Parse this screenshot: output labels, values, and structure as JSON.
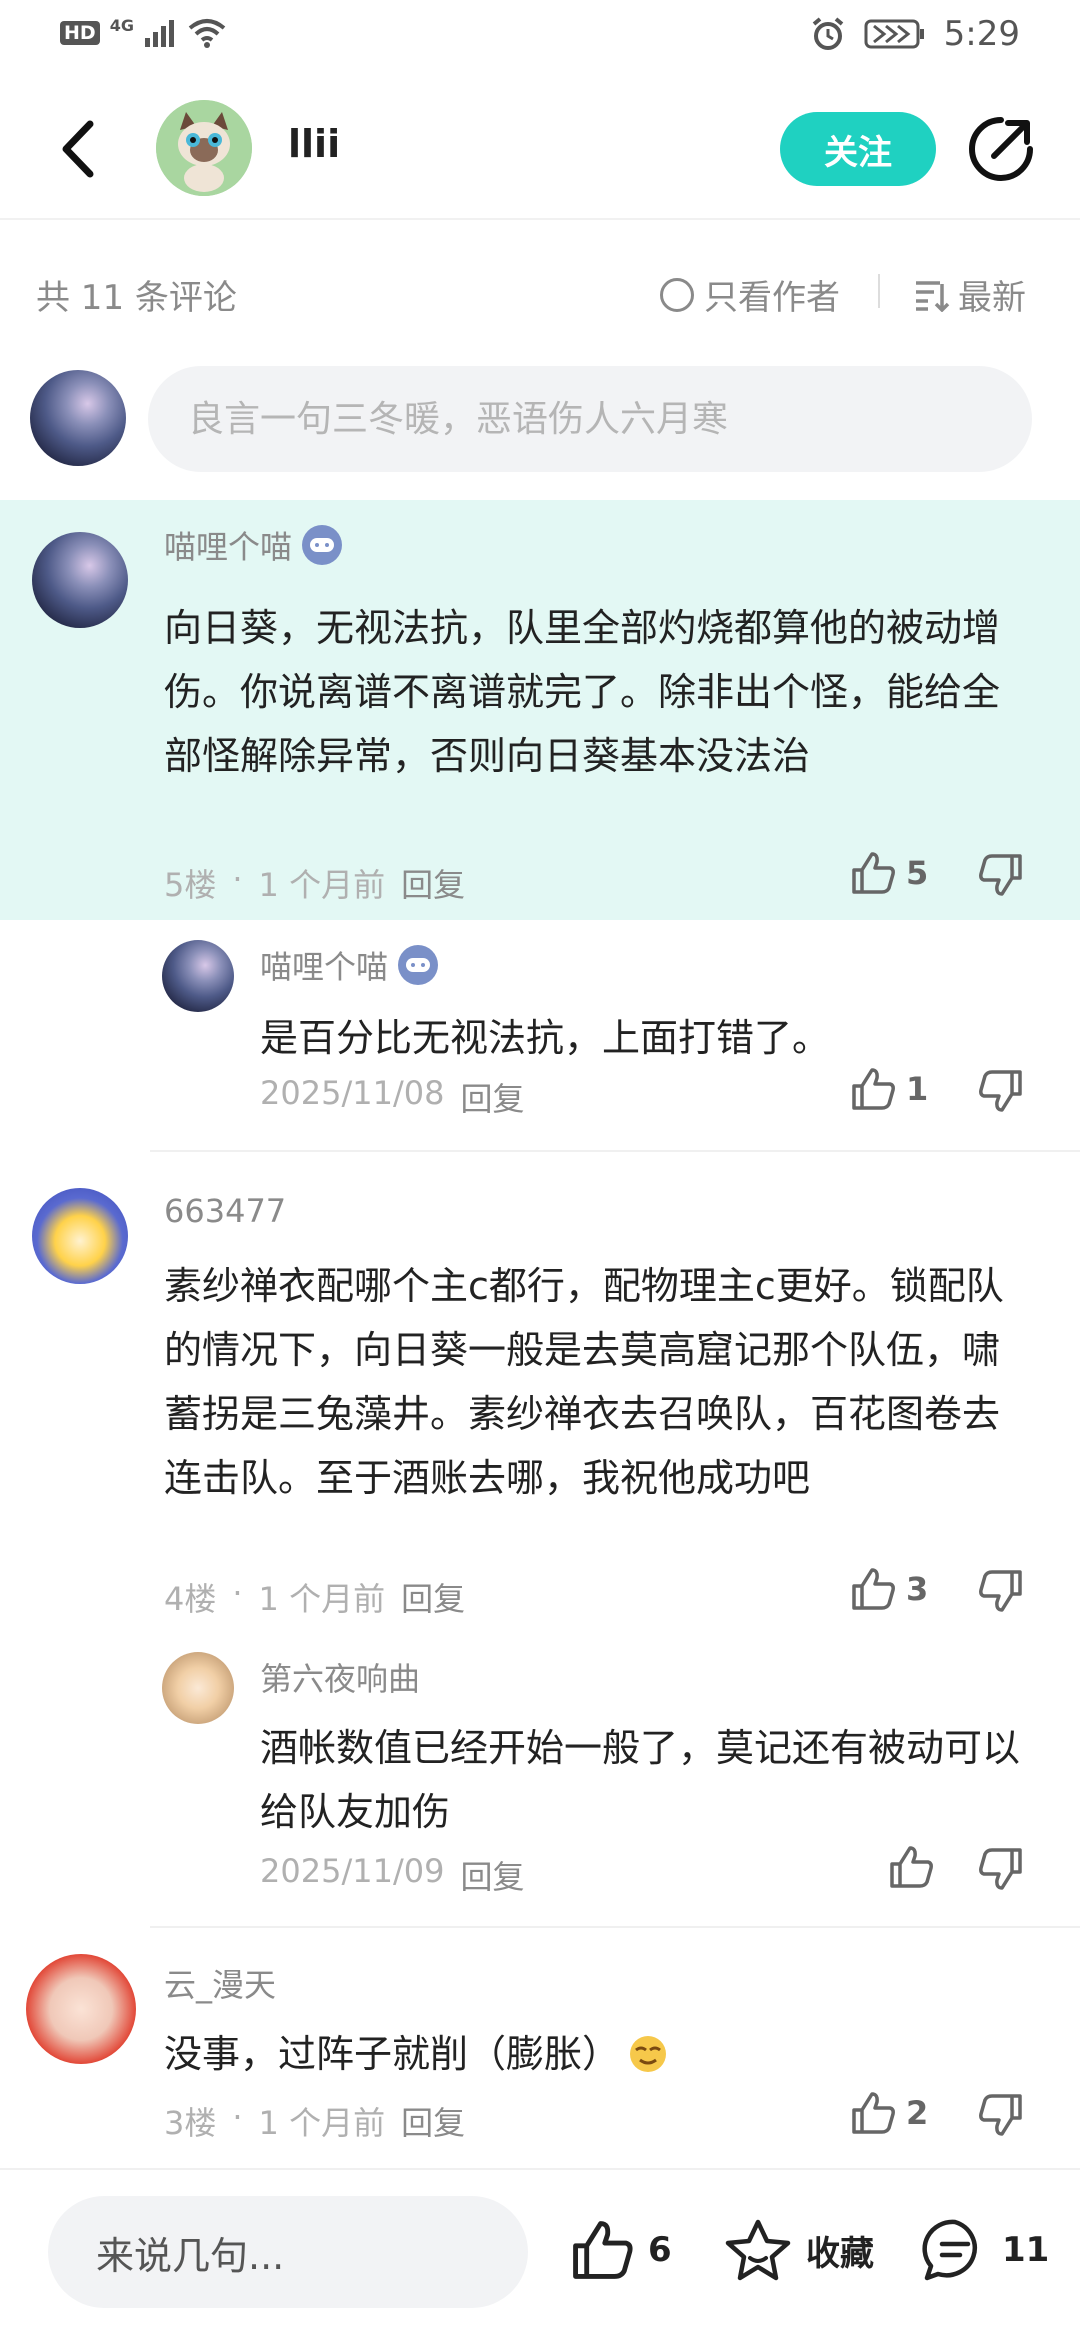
{
  "status_bar": {
    "hd": "HD",
    "network": "4G",
    "time": "5:29"
  },
  "header": {
    "author_name": "llii",
    "follow_label": "关注"
  },
  "comments_bar": {
    "count_text": "共 11 条评论",
    "author_only_label": "只看作者",
    "sort_label": "最新"
  },
  "composer": {
    "placeholder": "良言一句三冬暖，恶语伤人六月寒"
  },
  "comments": [
    {
      "user": "喵哩个喵",
      "text": "向日葵，无视法抗，队里全部灼烧都算他的被动增伤。你说离谱不离谱就完了。除非出个怪，能给全部怪解除异常，否则向日葵基本没法治",
      "floor": "5楼",
      "time": "1 个月前",
      "reply_label": "回复",
      "likes": "5",
      "replies": [
        {
          "user": "喵哩个喵",
          "text": "是百分比无视法抗，上面打错了。",
          "date": "2025/11/08",
          "reply_label": "回复",
          "likes": "1"
        }
      ]
    },
    {
      "user": "663477",
      "text": "素纱禅衣配哪个主c都行，配物理主c更好。锁配队的情况下，向日葵一般是去莫高窟记那个队伍，啸蓄拐是三兔藻井。素纱禅衣去召唤队，百花图卷去连击队。至于酒账去哪，我祝他成功吧",
      "floor": "4楼",
      "time": "1 个月前",
      "reply_label": "回复",
      "likes": "3",
      "replies": [
        {
          "user": "第六夜响曲",
          "text": "酒帐数值已经开始一般了，莫记还有被动可以给队友加伤",
          "date": "2025/11/09",
          "reply_label": "回复",
          "likes": ""
        }
      ]
    },
    {
      "user": "云_漫天",
      "text": "没事，过阵子就削（膨胀）",
      "floor": "3楼",
      "time": "1 个月前",
      "reply_label": "回复",
      "likes": "2",
      "replies": []
    }
  ],
  "bottom_bar": {
    "input_placeholder": "来说几句...",
    "like_count": "6",
    "favorite_label": "收藏",
    "comment_count": "11"
  },
  "colors": {
    "accent": "#1fd1c1",
    "highlight_bg": "#e3f8f4"
  }
}
